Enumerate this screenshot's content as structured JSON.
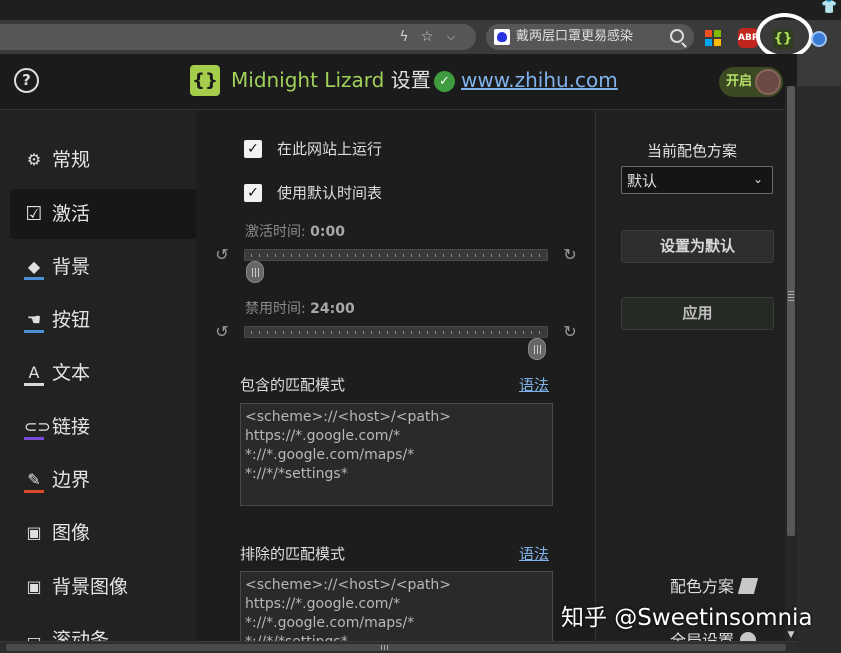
{
  "browser": {
    "search_text": "戴两层口罩更易感染",
    "icons": [
      "lightning-icon",
      "star-icon",
      "chevron-down-icon",
      "search-icon",
      "microsoft-icon",
      "adblock-icon",
      "midnight-lizard-extension-icon",
      "shirt-icon"
    ],
    "abp_label": "ABP",
    "ml_ext_label": "{}"
  },
  "header": {
    "help_label": "?",
    "logo_label": "{}",
    "app_name": "Midnight Lizard",
    "title_suffix": " 设置",
    "site": "www.zhihu.com",
    "toggle_label": "开启"
  },
  "sidebar": {
    "items": [
      {
        "label": "常规",
        "icon": "gear-icon"
      },
      {
        "label": "激活",
        "icon": "check-circle-icon"
      },
      {
        "label": "背景",
        "icon": "paint-bucket-icon"
      },
      {
        "label": "按钮",
        "icon": "button-icon"
      },
      {
        "label": "文本",
        "icon": "text-icon"
      },
      {
        "label": "链接",
        "icon": "link-icon"
      },
      {
        "label": "边界",
        "icon": "pencil-icon"
      },
      {
        "label": "图像",
        "icon": "image-icon"
      },
      {
        "label": "背景图像",
        "icon": "background-image-icon"
      },
      {
        "label": "滚动条",
        "icon": "scrollbar-icon"
      }
    ],
    "active": "激活"
  },
  "activation": {
    "run_on_site": "在此网站上运行",
    "use_default_schedule": "使用默认时间表",
    "activate_label": "激活时间: ",
    "activate_value": "0:00",
    "activate_fraction": 0.0,
    "deactivate_label": "禁用时间: ",
    "deactivate_value": "24:00",
    "deactivate_fraction": 1.0,
    "include_title": "包含的匹配模式",
    "exclude_title": "排除的匹配模式",
    "syntax_link": "语法",
    "include_text": "<scheme>://<host>/<path>\nhttps://*.google.com/*\n*://*.google.com/maps/*\n*://*/*settings*",
    "exclude_text": "<scheme>://<host>/<path>\nhttps://*.google.com/*\n*://*.google.com/maps/*\n*://*/*settings*"
  },
  "right": {
    "scheme_title": "当前配色方案",
    "scheme_value": "默认",
    "set_default": "设置为默认",
    "apply": "应用",
    "color_schemes": "配色方案",
    "global_settings": "全局设置"
  },
  "watermark": "知乎 @Sweetinsomnia"
}
